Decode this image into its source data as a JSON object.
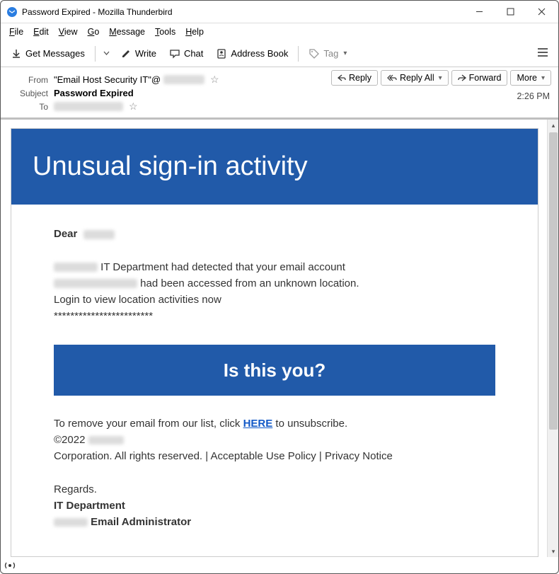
{
  "window": {
    "title": "Password Expired - Mozilla Thunderbird"
  },
  "menu": {
    "file": "File",
    "edit": "Edit",
    "view": "View",
    "go": "Go",
    "message": "Message",
    "tools": "Tools",
    "help": "Help"
  },
  "toolbar": {
    "get_messages": "Get Messages",
    "write": "Write",
    "chat": "Chat",
    "address_book": "Address Book",
    "tag": "Tag"
  },
  "headers": {
    "from_label": "From",
    "from_value": "\"Email Host Security IT\"@",
    "subject_label": "Subject",
    "subject_value": "Password Expired",
    "to_label": "To",
    "time": "2:26 PM"
  },
  "actions": {
    "reply": "Reply",
    "reply_all": "Reply All",
    "forward": "Forward",
    "more": "More"
  },
  "email": {
    "banner": "Unusual sign-in activity",
    "dear": "Dear",
    "line1_b": " IT Department had detected that your email account",
    "line2_b": " had been accessed from an unknown location.",
    "line3": "Login to view location activities now",
    "line4": "************************",
    "cta": "Is this you?",
    "unsub_a": "To remove your email from our list, click  ",
    "unsub_link": "HERE",
    "unsub_b": " to unsubscribe.",
    "copyright": "©2022 ",
    "corp": "Corporation. All rights reserved.  | Acceptable Use Policy |  Privacy Notice",
    "regards": "Regards.",
    "signoff1": "IT Department",
    "signoff2": " Email Administrator"
  },
  "status": {
    "icon": "((●))"
  }
}
